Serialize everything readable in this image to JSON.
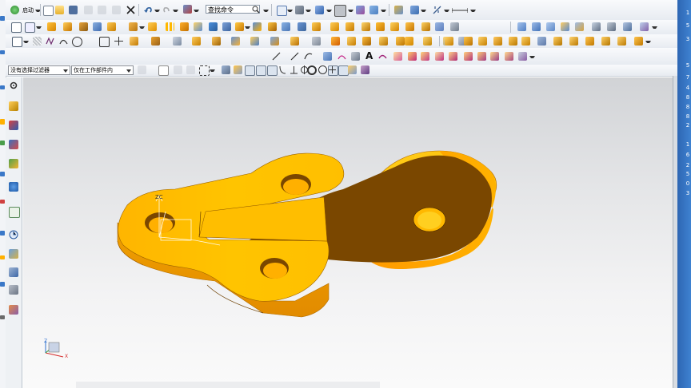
{
  "toolbar1": {
    "start_label": "启动",
    "find_command_placeholder": "查找命令"
  },
  "selection_bar": {
    "filter_value": "没有选择过滤器",
    "scope_value": "仅在工作部件内"
  },
  "right_edge_numbers": [
    "1",
    "5",
    "3",
    "5",
    "7",
    "4",
    "8",
    "8",
    "8",
    "2",
    "1",
    "6",
    "2",
    "5",
    "0",
    "3"
  ],
  "triad": {
    "x": "X",
    "y": "Y",
    "z": "Z"
  },
  "colors": {
    "part_face": "#ffb800",
    "part_highlight": "#ffcf1f",
    "part_side": "#f59f00",
    "part_shadow": "#7a4700",
    "viewport_top": "#d1d3d6",
    "viewport_bottom": "#fafafa",
    "taskbar_blue": "#3a78c8"
  },
  "icons": {
    "toolbar1": [
      "start-icon",
      "new-file-icon",
      "open-file-icon",
      "save-icon",
      "cut-icon",
      "copy-icon",
      "paste-icon",
      "delete-icon",
      "undo-icon",
      "redo-icon",
      "command-finder-icon",
      "search-icon",
      "view-icon",
      "orient-view-icon",
      "render-style-icon",
      "background-icon",
      "layer-icon",
      "snap-icon",
      "wcs-icon",
      "measure-icon"
    ],
    "navigator": [
      "settings-icon",
      "part-navigator-icon",
      "assembly-navigator-icon",
      "constraint-navigator-icon",
      "reuse-library-icon",
      "web-browser-icon",
      "history-icon",
      "system-materials-icon",
      "process-studio-icon",
      "roles-icon",
      "palette-icon"
    ]
  }
}
